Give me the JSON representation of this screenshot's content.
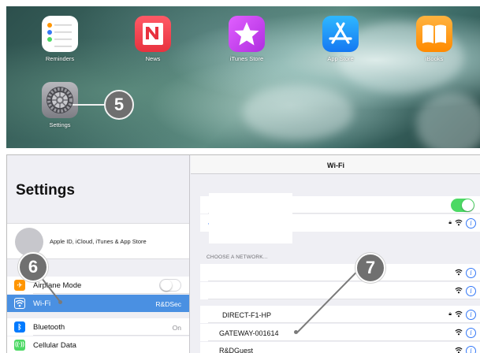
{
  "home_screen": {
    "apps": [
      {
        "label": "Reminders",
        "icon": "reminders-icon"
      },
      {
        "label": "News",
        "icon": "news-icon"
      },
      {
        "label": "iTunes Store",
        "icon": "itunes-store-icon"
      },
      {
        "label": "App Store",
        "icon": "app-store-icon"
      },
      {
        "label": "iBooks",
        "icon": "ibooks-icon"
      },
      {
        "label": "Settings",
        "icon": "settings-gear-icon"
      }
    ],
    "callout_settings": "5"
  },
  "settings": {
    "title": "Settings",
    "profile_text": "Apple ID, iCloud, iTunes & App Store",
    "rows": [
      {
        "label": "Airplane Mode",
        "value": "",
        "icon": "airplane-icon",
        "color": "#ff9500"
      },
      {
        "label": "Wi-Fi",
        "value": "R&DSec",
        "icon": "wifi-icon",
        "color": "#4a90e2"
      },
      {
        "label": "Bluetooth",
        "value": "On",
        "icon": "bluetooth-icon",
        "color": "#007aff"
      },
      {
        "label": "Cellular Data",
        "value": "",
        "icon": "cellular-icon",
        "color": "#4cd964"
      }
    ],
    "callout_wifi": "6"
  },
  "wifi": {
    "header": "Wi-Fi",
    "choose_network": "CHOOSE A NETWORK...",
    "networks": [
      {
        "name": "DIRECT-F1-HP",
        "locked": true
      },
      {
        "name": "GATEWAY-001614",
        "locked": false
      },
      {
        "name": "R&DGuest",
        "locked": false
      }
    ],
    "callout_network": "7",
    "toggle_color": "#4cd964",
    "accent_color": "#3478f6"
  }
}
